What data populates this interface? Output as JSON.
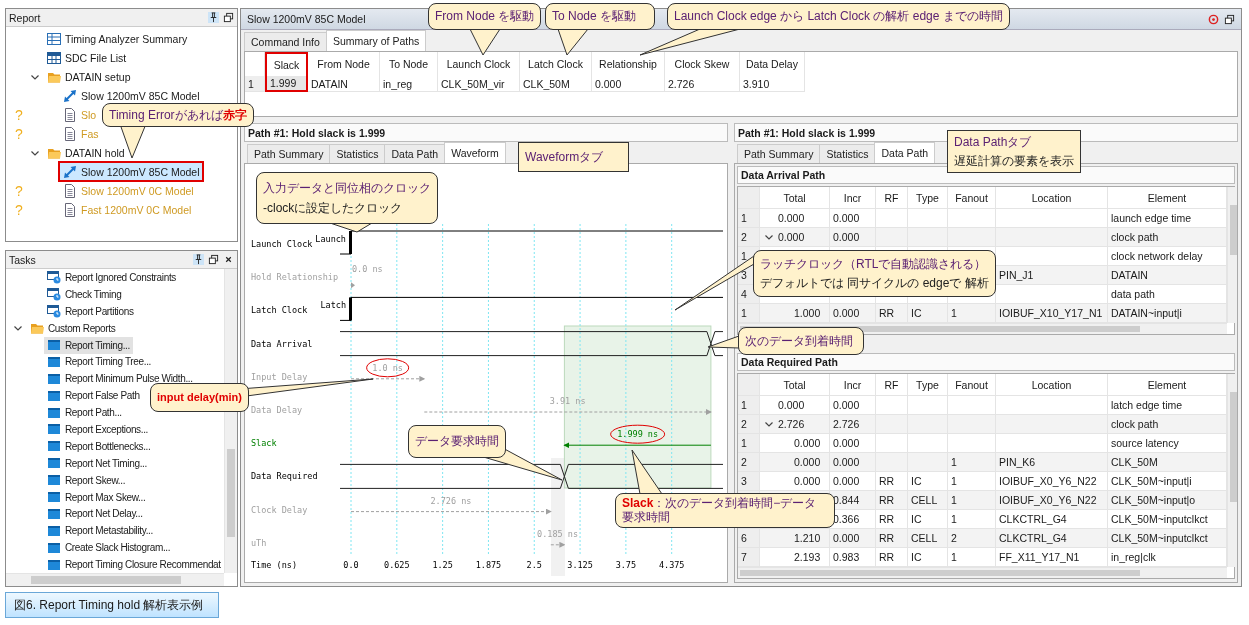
{
  "report_panel": {
    "title": "Report",
    "tree": [
      {
        "label": "Timing Analyzer Summary",
        "kind": "summary",
        "selected": false
      },
      {
        "label": "SDC File List",
        "kind": "table",
        "selected": false
      },
      {
        "label": "DATAIN setup",
        "kind": "folder",
        "selected": false,
        "expanded": true,
        "children": [
          {
            "label": "Slow 1200mV 85C Model",
            "kind": "timing",
            "warning": false,
            "selected": false,
            "highlighted": false
          },
          {
            "label": "Slo",
            "kind": "report",
            "warning": true,
            "mark": "?",
            "selected": false,
            "highlighted": false
          },
          {
            "label": "Fas",
            "kind": "report",
            "warning": true,
            "mark": "?",
            "selected": false,
            "highlighted": false
          }
        ]
      },
      {
        "label": "DATAIN hold",
        "kind": "folder",
        "selected": false,
        "expanded": true,
        "children": [
          {
            "label": "Slow 1200mV 85C Model",
            "kind": "timing",
            "warning": false,
            "selected": true,
            "highlighted": true
          },
          {
            "label": "Slow 1200mV 0C Model",
            "kind": "report",
            "warning": true,
            "mark": "?",
            "selected": false,
            "highlighted": false
          },
          {
            "label": "Fast 1200mV 0C Model",
            "kind": "report",
            "warning": true,
            "mark": "?",
            "selected": false,
            "highlighted": false
          }
        ]
      }
    ]
  },
  "tasks_panel": {
    "title": "Tasks",
    "tree": [
      {
        "label": "Report Ignored Constraints",
        "kind": "task",
        "selected": false
      },
      {
        "label": "Check Timing",
        "kind": "task",
        "selected": false
      },
      {
        "label": "Report Partitions",
        "kind": "task",
        "selected": false
      },
      {
        "label": "Custom Reports",
        "kind": "folder",
        "selected": false,
        "expanded": true,
        "children": [
          {
            "label": "Report Timing...",
            "kind": "custom",
            "selected": true
          },
          {
            "label": "Report Timing Tree...",
            "kind": "custom",
            "selected": false
          },
          {
            "label": "Report Minimum Pulse Width...",
            "kind": "custom",
            "selected": false
          },
          {
            "label": "Report False Path",
            "kind": "custom",
            "selected": false
          },
          {
            "label": "Report Path...",
            "kind": "custom",
            "selected": false
          },
          {
            "label": "Report Exceptions...",
            "kind": "custom",
            "selected": false
          },
          {
            "label": "Report Bottlenecks...",
            "kind": "custom",
            "selected": false
          },
          {
            "label": "Report Net Timing...",
            "kind": "custom",
            "selected": false
          },
          {
            "label": "Report Skew...",
            "kind": "custom",
            "selected": false
          },
          {
            "label": "Report Max Skew...",
            "kind": "custom",
            "selected": false
          },
          {
            "label": "Report Net Delay...",
            "kind": "custom",
            "selected": false
          },
          {
            "label": "Report Metastability...",
            "kind": "custom",
            "selected": false
          },
          {
            "label": "Create Slack Histogram...",
            "kind": "custom",
            "selected": false
          },
          {
            "label": "Report Timing Closure Recommendat",
            "kind": "custom",
            "selected": false
          }
        ]
      }
    ]
  },
  "report_view": {
    "title": "Slow 1200mV 85C Model",
    "tabs": [
      {
        "label": "Command Info",
        "selected": false
      },
      {
        "label": "Summary of Paths",
        "selected": true
      }
    ],
    "summary_table": {
      "columns": [
        {
          "label": "Slack",
          "highlighted": true
        },
        {
          "label": "From Node",
          "highlighted": false
        },
        {
          "label": "To Node",
          "highlighted": false
        },
        {
          "label": "Launch Clock",
          "highlighted": false
        },
        {
          "label": "Latch Clock",
          "highlighted": false
        },
        {
          "label": "Relationship",
          "highlighted": false
        },
        {
          "label": "Clock Skew",
          "highlighted": false
        },
        {
          "label": "Data Delay",
          "highlighted": false
        }
      ],
      "rows": [
        {
          "number": "1",
          "cells": [
            "1.999",
            "DATAIN",
            "in_reg",
            "CLK_50M_vir",
            "CLK_50M",
            "0.000",
            "2.726",
            "3.910"
          ]
        }
      ]
    }
  },
  "waveform_pane": {
    "header": "Path #1: Hold slack is 1.999",
    "tabs": [
      {
        "label": "Path Summary",
        "selected": false
      },
      {
        "label": "Statistics",
        "selected": false
      },
      {
        "label": "Data Path",
        "selected": false
      },
      {
        "label": "Waveform",
        "selected": true
      }
    ],
    "signals": [
      {
        "name": "Launch Clock",
        "kind": "clock",
        "edge_label": "Launch"
      },
      {
        "name": "Hold Relationship",
        "kind": "hold",
        "value": "0.0 ns"
      },
      {
        "name": "Latch Clock",
        "kind": "clock",
        "edge_label": "Latch"
      },
      {
        "name": "Data Arrival",
        "kind": "bus"
      },
      {
        "name": "Input Delay",
        "kind": "delay",
        "value": "1.0 ns",
        "circled": true
      },
      {
        "name": "Data Delay",
        "kind": "delay",
        "value": "3.91 ns"
      },
      {
        "name": "Slack",
        "kind": "slack",
        "value": "1.999 ns",
        "circled": true
      },
      {
        "name": "Data Required",
        "kind": "bus"
      },
      {
        "name": "Clock Delay",
        "kind": "delay",
        "value": "2.726 ns"
      },
      {
        "name": "uTh",
        "kind": "delay",
        "value": "0.185 ns"
      }
    ],
    "axis": {
      "label": "Time (ns)",
      "ticks": [
        "0.0",
        "0.625",
        "1.25",
        "1.875",
        "2.5",
        "3.125",
        "3.75",
        "4.375"
      ]
    }
  },
  "data_path_pane": {
    "header": "Path #1: Hold slack is 1.999",
    "tabs": [
      {
        "label": "Path Summary",
        "selected": false
      },
      {
        "label": "Statistics",
        "selected": false
      },
      {
        "label": "Data Path",
        "selected": true
      }
    ],
    "sections": [
      {
        "title": "Data Arrival Path",
        "columns": [
          "",
          "Total",
          "Incr",
          "RF",
          "Type",
          "Fanout",
          "Location",
          "Element"
        ],
        "rows": [
          {
            "cells": [
              "1",
              "0.000",
              "0.000",
              null,
              null,
              null,
              null,
              "launch edge time"
            ]
          },
          {
            "cells": [
              "2",
              "0.000",
              "0.000",
              null,
              null,
              null,
              null,
              "clock path"
            ],
            "expanded": true,
            "children": [
              {
                "cells": [
                  "1",
                  null,
                  null,
                  null,
                  null,
                  null,
                  null,
                  "clock network delay"
                ]
              }
            ]
          },
          {
            "cells": [
              "3",
              null,
              null,
              null,
              null,
              null,
              "PIN_J1",
              "DATAIN"
            ]
          },
          {
            "cells": [
              "4",
              null,
              null,
              null,
              null,
              null,
              null,
              "data path"
            ],
            "children": [
              {
                "cells": [
                  "1",
                  "1.000",
                  "0.000",
                  "RR",
                  "IC",
                  "1",
                  "IOIBUF_X10_Y17_N1",
                  "DATAIN~input|i"
                ]
              }
            ]
          }
        ]
      },
      {
        "title": "Data Required Path",
        "columns": [
          "",
          "Total",
          "Incr",
          "RF",
          "Type",
          "Fanout",
          "Location",
          "Element"
        ],
        "rows": [
          {
            "cells": [
              "1",
              "0.000",
              "0.000",
              null,
              null,
              null,
              null,
              "latch edge time"
            ]
          },
          {
            "cells": [
              "2",
              "2.726",
              "2.726",
              null,
              null,
              null,
              null,
              "clock path"
            ],
            "expanded": true,
            "children": [
              {
                "cells": [
                  "1",
                  "0.000",
                  "0.000",
                  null,
                  null,
                  null,
                  null,
                  "source latency"
                ]
              },
              {
                "cells": [
                  "2",
                  "0.000",
                  "0.000",
                  null,
                  null,
                  "1",
                  "PIN_K6",
                  "CLK_50M"
                ]
              },
              {
                "cells": [
                  "3",
                  "0.000",
                  "0.000",
                  "RR",
                  "IC",
                  "1",
                  "IOIBUF_X0_Y6_N22",
                  "CLK_50M~input|i"
                ]
              },
              {
                "cells": [
                  null,
                  null,
                  "0.844",
                  "RR",
                  "CELL",
                  "1",
                  "IOIBUF_X0_Y6_N22",
                  "CLK_50M~input|o"
                ]
              },
              {
                "cells": [
                  null,
                  null,
                  "0.366",
                  "RR",
                  "IC",
                  "1",
                  "CLKCTRL_G4",
                  "CLK_50M~inputclkct"
                ]
              },
              {
                "cells": [
                  "6",
                  "1.210",
                  "0.000",
                  "RR",
                  "CELL",
                  "2",
                  "CLKCTRL_G4",
                  "CLK_50M~inputclkct"
                ]
              },
              {
                "cells": [
                  "7",
                  "2.193",
                  "0.983",
                  "RR",
                  "IC",
                  "1",
                  "FF_X11_Y17_N1",
                  "in_reg|clk"
                ]
              }
            ]
          }
        ]
      }
    ]
  },
  "callouts": [
    {
      "kind": "bubble",
      "text": "Timing Errorがあれば**赤字**",
      "alert": false
    },
    {
      "kind": "bubble",
      "text": "From Node を駆動",
      "alert": false
    },
    {
      "kind": "bubble",
      "text": "To Node を駆動",
      "alert": false
    },
    {
      "kind": "bubble",
      "text": "Launch Clock edge から Latch Clock の解析 edge までの時間",
      "alert": false
    },
    {
      "kind": "note",
      "text": "Waveformタブ",
      "alert": false
    },
    {
      "kind": "bubble",
      "text": "入力データと同位相のクロック",
      "subtext": "-clockに設定したクロック",
      "alert": false
    },
    {
      "kind": "note",
      "text": "Data Pathタブ",
      "subtext": "遅延計算の要素を表示",
      "alert": false
    },
    {
      "kind": "bubble",
      "text": "ラッチクロック（RTLで自動認識される）",
      "subtext": "デフォルトでは 同サイクルの edgeで 解析",
      "alert": false
    },
    {
      "kind": "bubble",
      "text": "次のデータ到着時間",
      "alert": false
    },
    {
      "kind": "bubble",
      "text": "input delay(min)",
      "alert": true
    },
    {
      "kind": "bubble",
      "text": "データ要求時間",
      "alert": false
    },
    {
      "kind": "bubble",
      "text": "**Slack**：次のデータ到着時間−データ要求時間",
      "alert": false
    }
  ],
  "caption": "図6. Report Timing hold 解析表示例"
}
